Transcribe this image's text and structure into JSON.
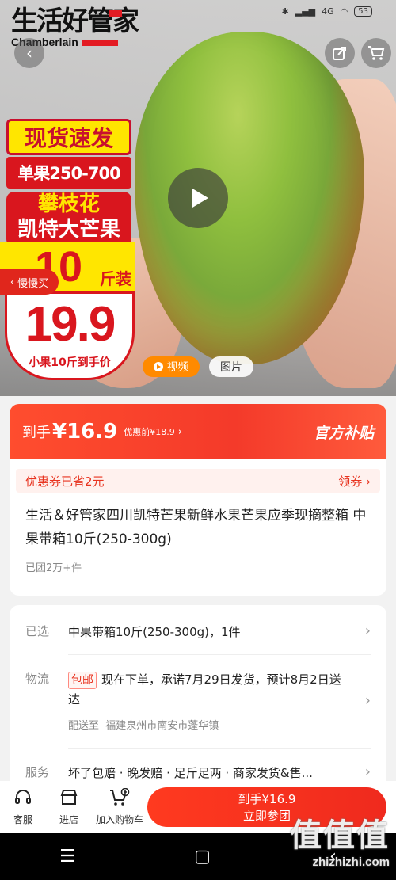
{
  "status": {
    "battery": "53",
    "network": "4G"
  },
  "logo": {
    "cn": "生活好管家",
    "en": "Chamberlain"
  },
  "hero": {
    "badge_stock": "现货速发",
    "badge_size": "单果250-700",
    "badge_origin": "攀枝花",
    "badge_name": "凯特大芒果",
    "badge_weight_num": "10",
    "badge_weight_unit": "斤装",
    "badge_price": "19.9",
    "badge_note": "小果10斤到手价",
    "slow_buy": "慢慢买",
    "tab_video": "视频",
    "tab_photo": "图片"
  },
  "price": {
    "label": "到手",
    "currency": "¥",
    "value": "16.9",
    "before": "优惠前¥18.9",
    "subsidy": "官方补贴"
  },
  "coupon": {
    "saved": "优惠券已省2元",
    "get": "领券"
  },
  "product": {
    "title": "生活＆好管家四川凯特芒果新鲜水果芒果应季现摘整箱 中果带箱10斤(250-300g)",
    "sold": "已团2万+件"
  },
  "details": {
    "selected_key": "已选",
    "selected_value": "中果带箱10斤(250-300g)，1件",
    "logistics_key": "物流",
    "logistics_tag": "包邮",
    "logistics_value": "现在下单，承诺7月29日发货，预计8月2日送达",
    "ship_to": "配送至",
    "ship_to_value": "福建泉州市南安市蓬华镇",
    "service_key": "服务",
    "service_value": "坏了包赔 · 晚发赔 · 足斤足两 · 商家发货&售..."
  },
  "bottom": {
    "service": "客服",
    "store": "进店",
    "cart": "加入购物车",
    "buy_line1": "到手¥16.9",
    "buy_line2": "立即参团"
  },
  "watermark": {
    "cn": "值值值",
    "en": "zhizhizhi.com"
  }
}
